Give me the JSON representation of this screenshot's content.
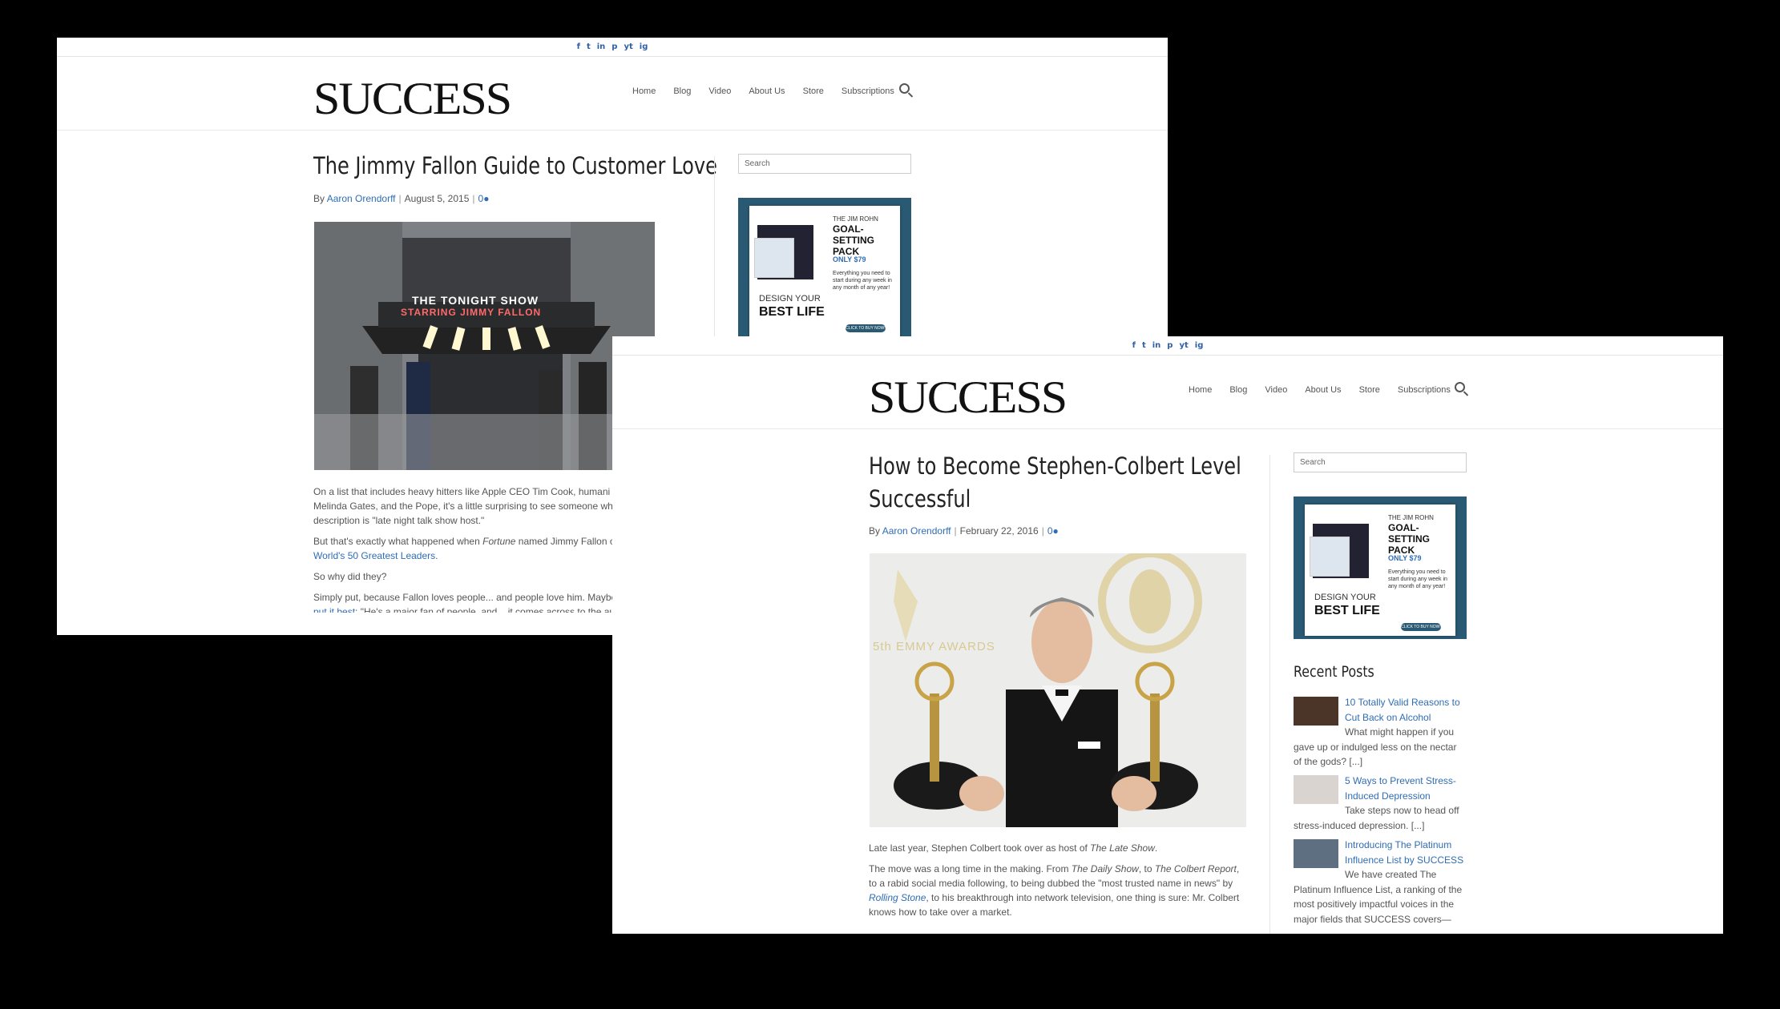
{
  "social_icons": [
    "f",
    "t",
    "in",
    "p",
    "yt",
    "ig"
  ],
  "colors": {
    "link": "#2f6db5",
    "ad_teal": "#2a5a73",
    "background": "#000000"
  },
  "window1": {
    "logo": "SUCCESS",
    "nav": [
      "Home",
      "Blog",
      "Video",
      "About Us",
      "Store",
      "Subscriptions"
    ],
    "title": "The Jimmy Fallon Guide to Customer Love",
    "by": "By",
    "author": "Aaron Orendorff",
    "date": "August 5, 2015",
    "comments": "0",
    "search_placeholder": "Search",
    "ad": {
      "name": "THE JIM ROHN",
      "headline": "GOAL-SETTING PACK",
      "price": "ONLY $79",
      "blurb": "Everything you need to start during any week in any month of any year!",
      "tag1": "DESIGN YOUR",
      "tag2": "BEST LIFE",
      "cta": "CLICK TO BUY NOW!"
    },
    "photo_sign_top": "THE TONIGHT SHOW",
    "photo_sign_bottom": "STARRING JIMMY FALLON",
    "p1": "On a list that includes heavy hitters like Apple CEO Tim Cook, humani Melinda Gates, and the Pope, it's a little surprising to see someone wh description is \"late night talk show host.\"",
    "p2_a": "But that's exactly what happened when ",
    "p2_em": "Fortune",
    "p2_b": " named Jimmy Fallon o",
    "p2_link": "World's 50 Greatest Leaders.",
    "p3": "So why did they?",
    "p4_a": "Simply put, because Fallon loves people... and people love him. Maybe",
    "p4_link": "put it best",
    "p4_b": ": \"He's a major fan of people, and... it comes across to the au this guy who has the same enthusiasms as you, but he happens to have"
  },
  "window2": {
    "logo": "SUCCESS",
    "nav": [
      "Home",
      "Blog",
      "Video",
      "About Us",
      "Store",
      "Subscriptions"
    ],
    "title_line1": "How to Become Stephen-Colbert Level",
    "title_line2": "Successful",
    "by": "By",
    "author": "Aaron Orendorff",
    "date": "February 22, 2016",
    "comments": "0",
    "search_placeholder": "Search",
    "photo_text": "5th EMMY AWARDS",
    "p1_a": "Late last year, Stephen Colbert took over as host of ",
    "p1_em": "The Late Show",
    "p1_b": ".",
    "p2_a": "The move was a long time in the making. From ",
    "p2_em1": "The Daily Show",
    "p2_b": ", to ",
    "p2_em2": "The Colbert Report",
    "p2_c": ", to a rabid social media following, to being dubbed the \"most trusted name in news\" by ",
    "p2_link": "Rolling Stone",
    "p2_d": ", to his breakthrough into network television, one thing is sure: Mr. Colbert knows how to take over a market.",
    "recent_posts_heading": "Recent Posts",
    "posts": [
      {
        "title": "10 Totally Valid Reasons to Cut Back on Alcohol",
        "excerpt": "What might happen if you gave up or indulged less on the nectar of the gods? [...]"
      },
      {
        "title": "5 Ways to Prevent Stress-Induced Depression",
        "excerpt": "Take steps now to head off stress-induced depression. [...]"
      },
      {
        "title": "Introducing The Platinum Influence List by SUCCESS",
        "excerpt": "We have created The Platinum Influence List, a ranking of the most positively impactful voices in the major fields that SUCCESS covers—"
      }
    ]
  }
}
